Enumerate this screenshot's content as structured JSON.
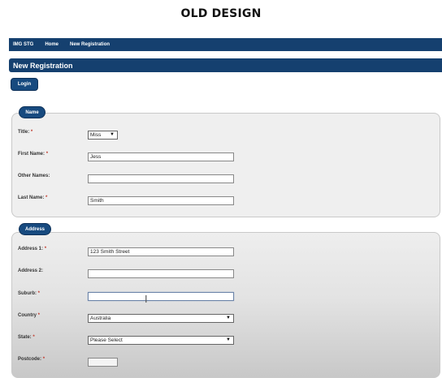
{
  "caption": "OLD DESIGN",
  "nav": {
    "items": [
      "IMG STG",
      "Home",
      "New Registration"
    ]
  },
  "page_title": "New Registration",
  "login_label": "Login",
  "name_section": {
    "legend": "Name",
    "title_label": "Title:",
    "title_value": "Miss",
    "first_name_label": "First Name:",
    "first_name_value": "Jess",
    "other_names_label": "Other Names:",
    "other_names_value": "",
    "last_name_label": "Last Name:",
    "last_name_value": "Smith"
  },
  "address_section": {
    "legend": "Address",
    "address1_label": "Address 1:",
    "address1_value": "123 Smith Street",
    "address2_label": "Address 2:",
    "address2_value": "",
    "suburb_label": "Suburb:",
    "suburb_value": "",
    "country_label": "Country",
    "country_value": "Australia",
    "state_label": "State:",
    "state_value": "Please Select",
    "postcode_label": "Postcode:"
  },
  "required_marker": "*",
  "select_arrow": "▼",
  "cursor_glyph": "I",
  "colors": {
    "nav_bg": "#15406f",
    "button_bg": "#174a7f",
    "required": "#c0392b"
  }
}
